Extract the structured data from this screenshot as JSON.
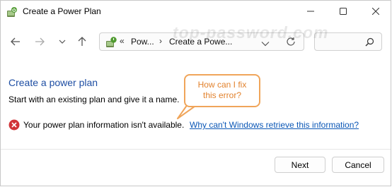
{
  "window": {
    "title": "Create a Power Plan",
    "icon": "power-options-icon"
  },
  "navigation": {
    "back_icon": "arrow-left-icon",
    "forward_icon": "arrow-right-icon",
    "recent_icon": "chevron-down-icon",
    "up_icon": "arrow-up-icon",
    "breadcrumb_overflow": "«",
    "breadcrumbs": [
      "Pow...",
      "Create a Powe..."
    ],
    "refresh_icon": "refresh-icon",
    "search_icon": "search-icon"
  },
  "watermark": "top-password.com",
  "content": {
    "title": "Create a power plan",
    "description": "Start with an existing plan and give it a name.",
    "error_text": "Your power plan information isn't available.",
    "error_link": "Why can't Windows retrieve this information?"
  },
  "callout": {
    "line1": "How can I fix",
    "line2": "this error?",
    "color": "#f0a55a"
  },
  "footer": {
    "next_label": "Next",
    "cancel_label": "Cancel"
  },
  "colors": {
    "title_blue": "#1e4ea3",
    "link_blue": "#0b57b6",
    "error_red": "#d13438"
  }
}
